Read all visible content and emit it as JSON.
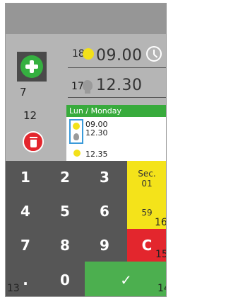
{
  "labels": {
    "add_number": "7",
    "row1_number": "18",
    "row2_number": "17",
    "delete_number": "12",
    "decimal_number": "13",
    "confirm_number": "14",
    "clear_number": "15",
    "sec_number": "16"
  },
  "times": {
    "sun_time": "09.00",
    "bulb_time": "12.30"
  },
  "schedule": {
    "header": "Lun / Monday",
    "entries": [
      {
        "line1": "09.00",
        "line2": "12.30"
      },
      {
        "line1": "12.35"
      }
    ]
  },
  "keypad": {
    "keys": [
      "1",
      "2",
      "3",
      "4",
      "5",
      "6",
      "7",
      "8",
      "9",
      ".",
      "0"
    ],
    "sec_label": "Sec.",
    "sec_value": "01",
    "sec_value2": "59",
    "clear_label": "C",
    "confirm_label": "✓"
  },
  "colors": {
    "green": "#38ab3c",
    "red": "#e3262d",
    "yellow": "#f4e31a",
    "keypad": "#565656",
    "panel": "#b5b5b5"
  }
}
